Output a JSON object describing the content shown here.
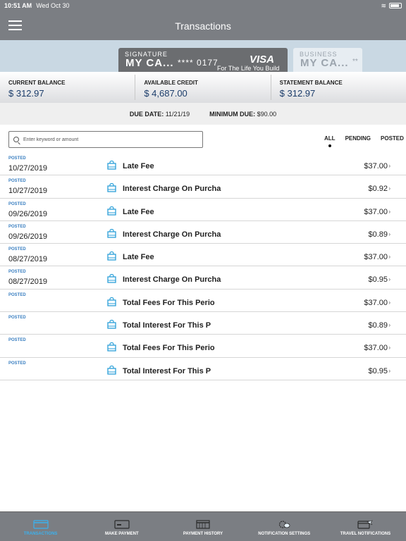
{
  "status_bar": {
    "time": "10:51 AM",
    "date": "Wed Oct 30"
  },
  "header": {
    "title": "Transactions"
  },
  "cards": [
    {
      "brand_small": "SIGNATURE",
      "brand_big": "MY CA...",
      "masked_number": "**** 0177",
      "network": "VISA",
      "tagline": "For The Life You Build"
    },
    {
      "brand_small": "BUSINESS",
      "brand_big": "MY CA...",
      "masked_number": "**"
    }
  ],
  "balances": {
    "current": {
      "label": "CURRENT BALANCE",
      "value": "$ 312.97"
    },
    "available": {
      "label": "AVAILABLE CREDIT",
      "value": "$ 4,687.00"
    },
    "statement": {
      "label": "STATEMENT BALANCE",
      "value": "$ 312.97"
    }
  },
  "due": {
    "due_label": "DUE DATE:",
    "due_value": "11/21/19",
    "min_label": "MINIMUM DUE:",
    "min_value": "$90.00"
  },
  "search": {
    "placeholder": "Enter keyword or amount"
  },
  "filters": {
    "all": "ALL",
    "pending": "PENDING",
    "posted": "POSTED"
  },
  "transactions": [
    {
      "status": "POSTED",
      "date": "10/27/2019",
      "description": "Late Fee",
      "amount": "$37.00"
    },
    {
      "status": "POSTED",
      "date": "10/27/2019",
      "description": "Interest Charge On Purcha",
      "amount": "$0.92"
    },
    {
      "status": "POSTED",
      "date": "09/26/2019",
      "description": "Late Fee",
      "amount": "$37.00"
    },
    {
      "status": "POSTED",
      "date": "09/26/2019",
      "description": "Interest Charge On Purcha",
      "amount": "$0.89"
    },
    {
      "status": "POSTED",
      "date": "08/27/2019",
      "description": "Late Fee",
      "amount": "$37.00"
    },
    {
      "status": "POSTED",
      "date": "08/27/2019",
      "description": "Interest Charge On Purcha",
      "amount": "$0.95"
    },
    {
      "status": "POSTED",
      "date": "",
      "description": "Total Fees For This Perio",
      "amount": "$37.00"
    },
    {
      "status": "POSTED",
      "date": "",
      "description": "Total Interest For This P",
      "amount": "$0.89"
    },
    {
      "status": "POSTED",
      "date": "",
      "description": "Total Fees For This Perio",
      "amount": "$37.00"
    },
    {
      "status": "POSTED",
      "date": "",
      "description": "Total Interest For This P",
      "amount": "$0.95"
    }
  ],
  "tabbar": {
    "transactions": "TRANSACTIONS",
    "make_payment": "MAKE PAYMENT",
    "payment_history": "PAYMENT HISTORY",
    "notification_settings": "NOTIFICATION SETTINGS",
    "travel_notifications": "TRAVEL NOTIFICATIONS"
  },
  "colors": {
    "bar_gray": "#7b7e83",
    "accent_blue": "#3ab2f0",
    "balance_blue": "#1c3d6b",
    "status_blue": "#3a7fc1",
    "card_band": "#c9d8e3"
  }
}
